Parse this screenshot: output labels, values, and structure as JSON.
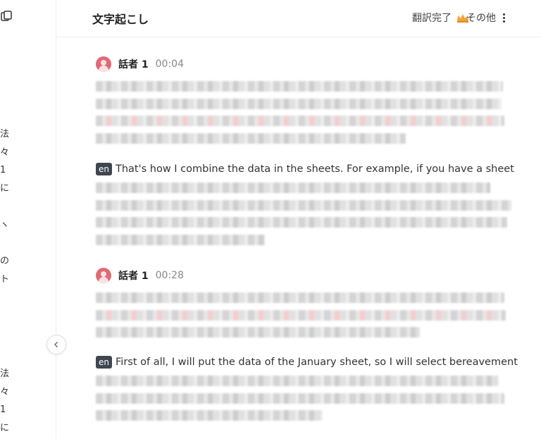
{
  "header": {
    "title": "文字起こし",
    "translate_status": "翻訳完了",
    "more_label": "その他"
  },
  "left_rail": {
    "chars_a": [
      "法",
      "々",
      "1",
      "に",
      "",
      "ヽ",
      "",
      "の",
      "ト"
    ],
    "chars_b": [
      "法",
      "々",
      "1",
      "に"
    ]
  },
  "segments": [
    {
      "speaker": "話者 1",
      "time": "00:04",
      "translation_badge": "en",
      "translation": "That's how I combine the data in the sheets. For example, if you have a sheet"
    },
    {
      "speaker": "話者 1",
      "time": "00:28",
      "translation_badge": "en",
      "translation": "First of all, I will put the data of the January sheet, so I will select bereavement"
    }
  ],
  "colors": {
    "avatar": "#e06a74",
    "badge": "#3e4650",
    "crown": "#f3a23a"
  }
}
